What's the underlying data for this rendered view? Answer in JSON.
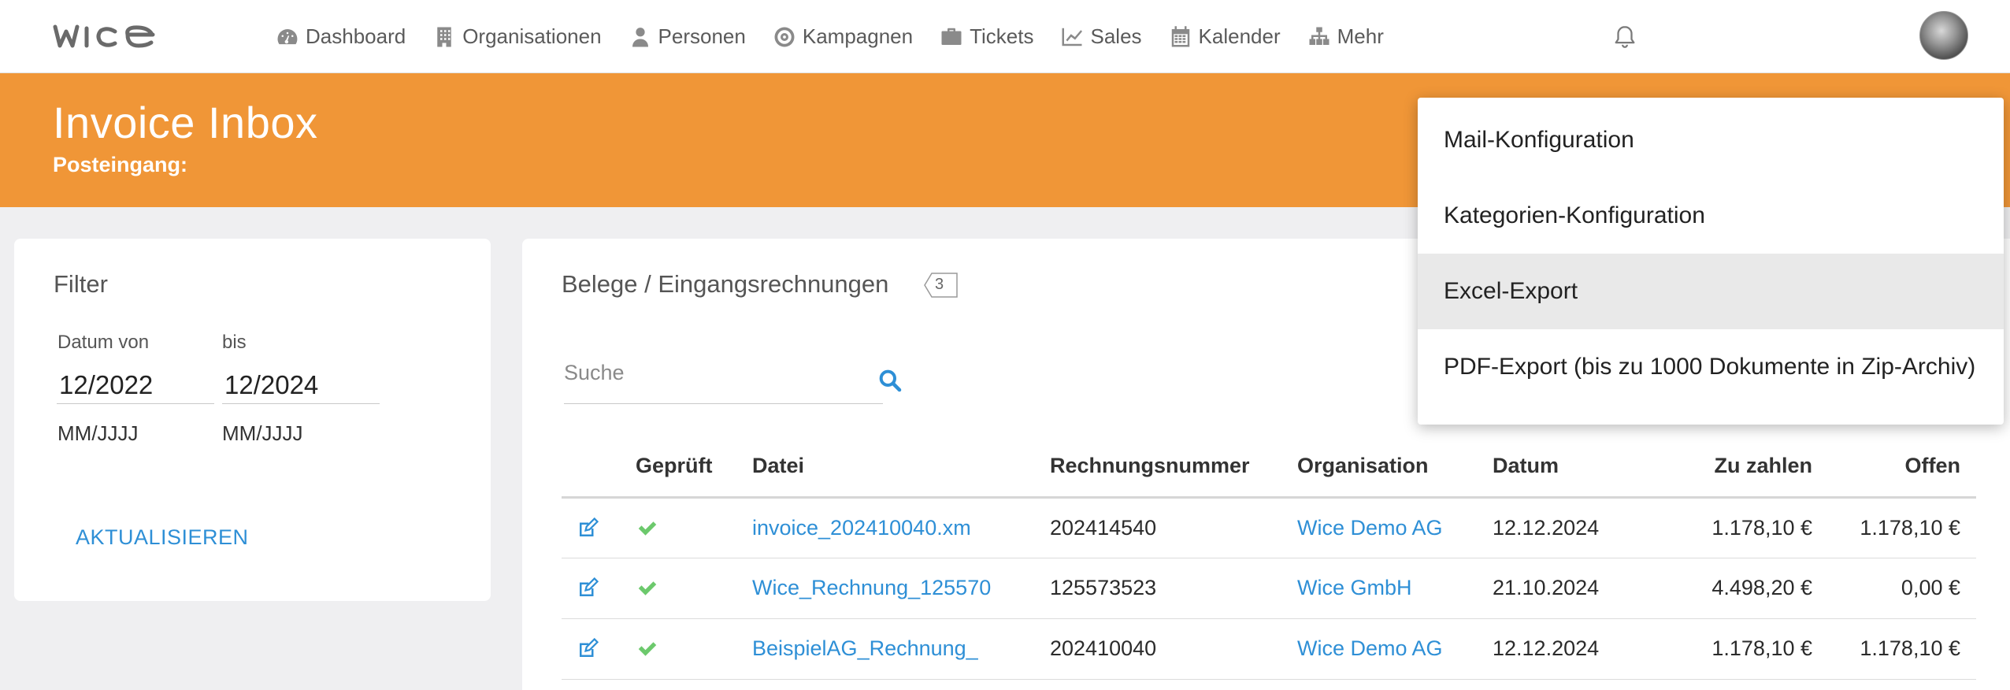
{
  "app": {
    "logo": "wice"
  },
  "nav": {
    "items": [
      {
        "label": "Dashboard",
        "icon": "dashboard-icon"
      },
      {
        "label": "Organisationen",
        "icon": "building-icon"
      },
      {
        "label": "Personen",
        "icon": "user-icon"
      },
      {
        "label": "Kampagnen",
        "icon": "target-icon"
      },
      {
        "label": "Tickets",
        "icon": "briefcase-icon"
      },
      {
        "label": "Sales",
        "icon": "line-chart-icon"
      },
      {
        "label": "Kalender",
        "icon": "calendar-icon"
      },
      {
        "label": "Mehr",
        "icon": "sitemap-icon"
      }
    ]
  },
  "header": {
    "title": "Invoice Inbox",
    "subtitle": "Posteingang:"
  },
  "filter": {
    "title": "Filter",
    "from_label": "Datum von",
    "to_label": "bis",
    "from_value": "12/2022",
    "to_value": "12/2024",
    "from_hint": "MM/JJJJ",
    "to_hint": "MM/JJJJ",
    "update_label": "AKTUALISIEREN"
  },
  "list": {
    "title": "Belege / Eingangsrechnungen",
    "count": "3",
    "search_placeholder": "Suche",
    "columns": [
      "",
      "Geprüft",
      "Datei",
      "Rechnungsnummer",
      "Organisation",
      "Datum",
      "Zu zahlen",
      "Offen"
    ],
    "rows": [
      {
        "file": "invoice_202410040.xm",
        "number": "202414540",
        "org": "Wice Demo AG",
        "date": "12.12.2024",
        "to_pay": "1.178,10 €",
        "open": "1.178,10 €"
      },
      {
        "file": "Wice_Rechnung_125570",
        "number": "125573523",
        "org": "Wice GmbH",
        "date": "21.10.2024",
        "to_pay": "4.498,20 €",
        "open": "0,00 €"
      },
      {
        "file": "BeispielAG_Rechnung_",
        "number": "202410040",
        "org": "Wice Demo AG",
        "date": "12.12.2024",
        "to_pay": "1.178,10 €",
        "open": "1.178,10 €"
      }
    ]
  },
  "menu": {
    "items": [
      {
        "label": "Mail-Konfiguration"
      },
      {
        "label": "Kategorien-Konfiguration"
      },
      {
        "label": "Excel-Export",
        "active": true
      },
      {
        "label": "PDF-Export (bis zu 1000 Dokumente in Zip-Archiv)"
      }
    ]
  },
  "colors": {
    "accent": "#f09637",
    "link": "#2e8fd6",
    "check": "#6cc96c"
  }
}
